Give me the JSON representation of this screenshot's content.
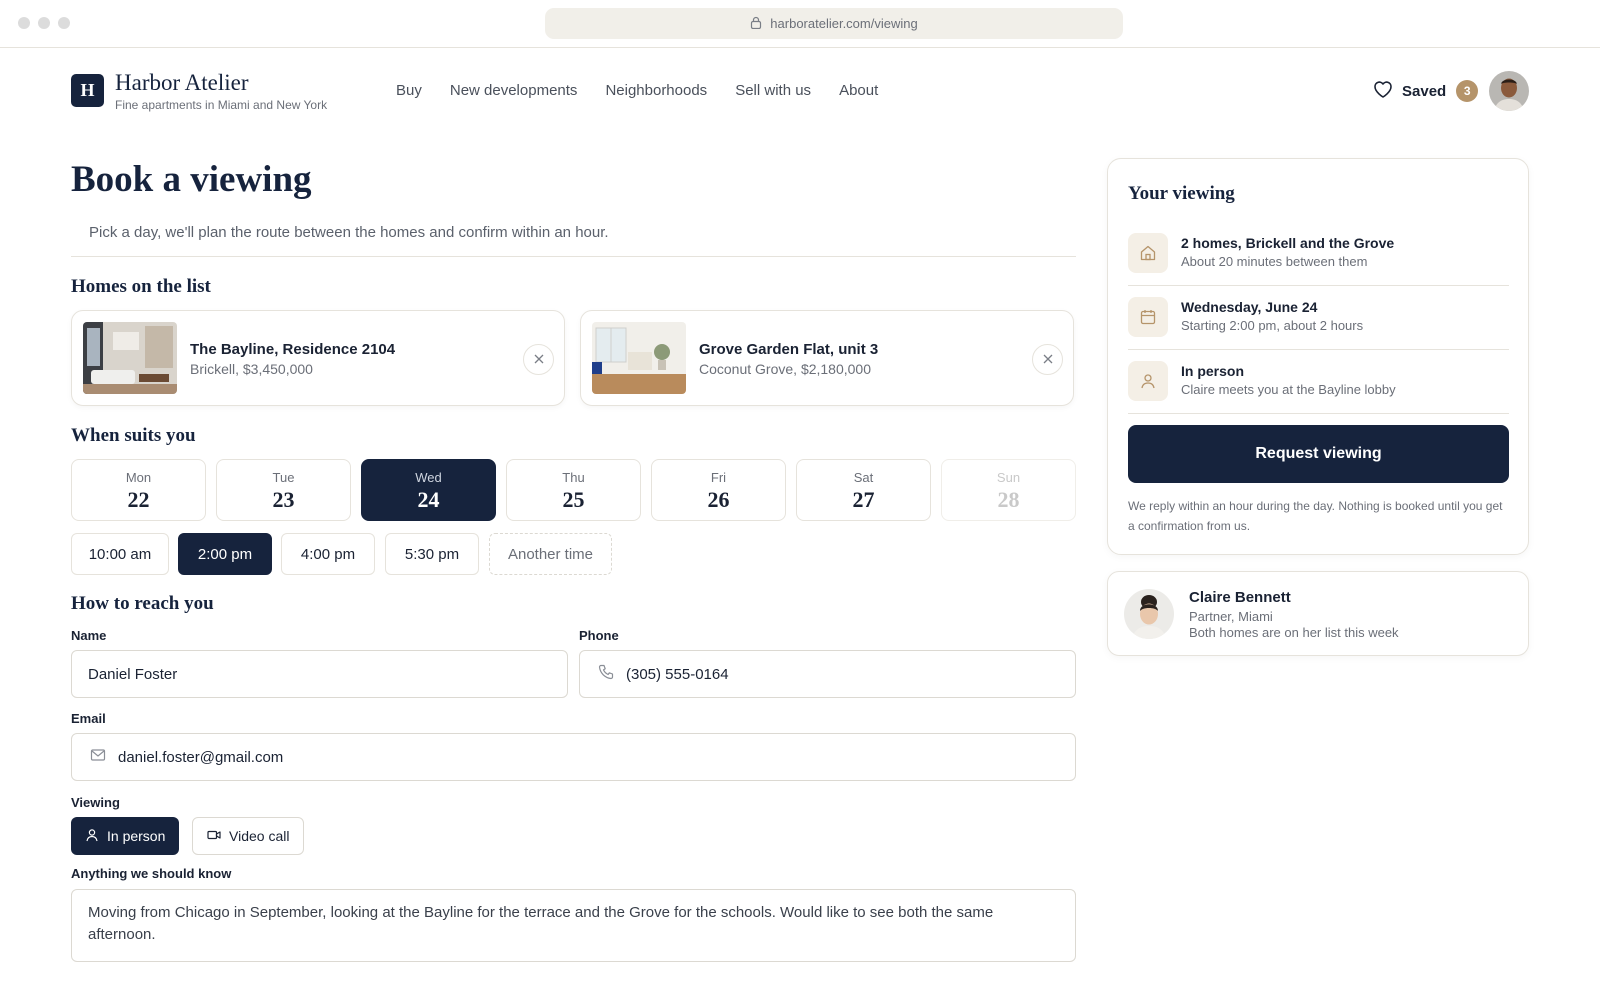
{
  "browser": {
    "url": "harboratelier.com/viewing"
  },
  "header": {
    "logo_letter": "H",
    "brand_name": "Harbor Atelier",
    "brand_tagline": "Fine apartments in Miami and New York",
    "nav": [
      "Buy",
      "New developments",
      "Neighborhoods",
      "Sell with us",
      "About"
    ],
    "saved_label": "Saved",
    "saved_count": "3"
  },
  "page": {
    "title": "Book a viewing",
    "subtitle": "Pick a day, we'll plan the route between the homes and confirm within an hour."
  },
  "homes": {
    "heading": "Homes on the list",
    "items": [
      {
        "title": "The Bayline, Residence 2104",
        "sub": "Brickell, $3,450,000"
      },
      {
        "title": "Grove Garden Flat, unit 3",
        "sub": "Coconut Grove, $2,180,000"
      }
    ]
  },
  "schedule": {
    "heading": "When suits you",
    "days": [
      {
        "name": "Mon",
        "num": "22"
      },
      {
        "name": "Tue",
        "num": "23"
      },
      {
        "name": "Wed",
        "num": "24"
      },
      {
        "name": "Thu",
        "num": "25"
      },
      {
        "name": "Fri",
        "num": "26"
      },
      {
        "name": "Sat",
        "num": "27"
      },
      {
        "name": "Sun",
        "num": "28"
      }
    ],
    "selected_day": "Wed 24",
    "times": [
      "10:00 am",
      "2:00 pm",
      "4:00 pm",
      "5:30 pm",
      "Another time"
    ],
    "selected_time": "2:00 pm"
  },
  "contact": {
    "heading": "How to reach you",
    "name_label": "Name",
    "name_value": "Daniel Foster",
    "phone_label": "Phone",
    "phone_value": "(305) 555-0164",
    "email_label": "Email",
    "email_value": "daniel.foster@gmail.com",
    "viewing_label": "Viewing",
    "viewing_in_person": "In person",
    "viewing_video": "Video call",
    "notes_label": "Anything we should know",
    "notes_value": "Moving from Chicago in September, looking at the Bayline for the terrace and the Grove for the schools. Would like to see both the same afternoon."
  },
  "summary": {
    "title": "Your viewing",
    "rows": [
      {
        "icon": "home-icon",
        "main": "2 homes, Brickell and the Grove",
        "sub": "About 20 minutes between them"
      },
      {
        "icon": "calendar-icon",
        "main": "Wednesday, June 24",
        "sub": "Starting 2:00 pm, about 2 hours"
      },
      {
        "icon": "person-icon",
        "main": "In person",
        "sub": "Claire meets you at the Bayline lobby"
      }
    ],
    "button": "Request viewing",
    "note": "We reply within an hour during the day. Nothing is booked until you get a confirmation from us."
  },
  "agent": {
    "name": "Claire Bennett",
    "role": "Partner, Miami",
    "note": "Both homes are on her list this week"
  },
  "colors": {
    "navy": "#16233d",
    "accent_gold": "#b5946a",
    "icon_bg": "#f4efe6",
    "border": "#e6e3dc"
  }
}
